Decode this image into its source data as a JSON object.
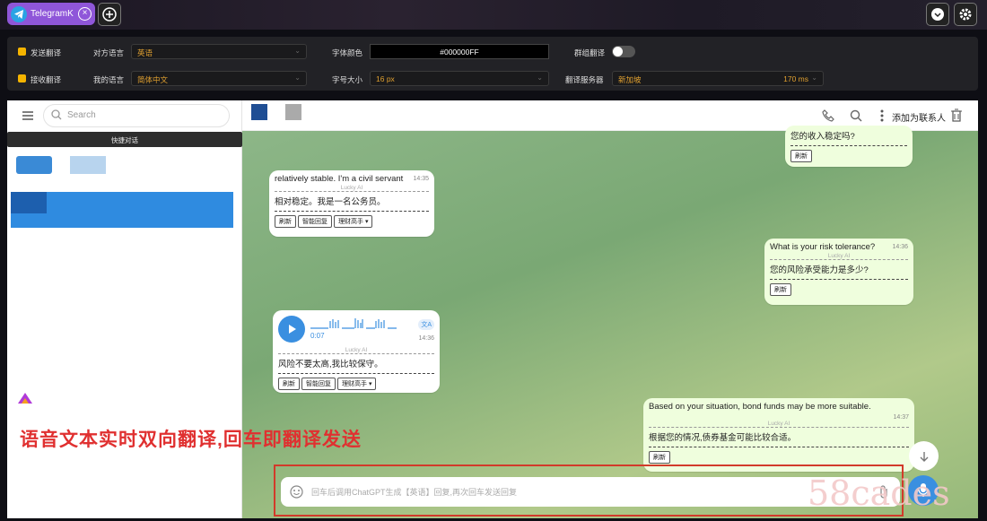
{
  "tab": {
    "title": "TelegramK"
  },
  "settings": {
    "send_translate": "发送翻译",
    "recv_translate": "接收翻译",
    "their_lang_label": "对方语言",
    "their_lang": "英语",
    "my_lang_label": "我的语言",
    "my_lang": "简体中文",
    "font_color_label": "字体颜色",
    "font_color": "#000000FF",
    "font_size_label": "字号大小",
    "font_size": "16 px",
    "group_translate_label": "群组翻译",
    "server_label": "翻译服务器",
    "server": "新加坡",
    "latency": "170 ms"
  },
  "left": {
    "search_placeholder": "Search",
    "quick_label": "快捷对话"
  },
  "header": {
    "add_contact": "添加为联系人"
  },
  "messages": [
    {
      "text": "您的收入稳定吗?",
      "btn": "刷新"
    },
    {
      "text": "relatively stable. I'm a civil servant",
      "time": "14:35",
      "sep": "Lucky AI",
      "tr": "相对稳定。我是一名公务员。",
      "b1": "刷新",
      "b2": "智能回复",
      "b3": "理财高手 ▾"
    },
    {
      "text": "What is your risk tolerance?",
      "time": "14:36",
      "sep": "Lucky AI",
      "tr": "您的风险承受能力是多少?",
      "b1": "刷新"
    },
    {
      "dur": "0:07",
      "time": "14:36",
      "badge": "文A",
      "sep": "Lucky AI",
      "tr": "风险不要太高,我比较保守。",
      "b1": "刷新",
      "b2": "智能回复",
      "b3": "理财高手 ▾"
    },
    {
      "text": "Based on your situation, bond funds may be more suitable.",
      "time": "14:37",
      "sep": "Lucky AI",
      "tr": "根据您的情况,债券基金可能比较合适。",
      "b1": "刷新"
    }
  ],
  "input": {
    "placeholder": "回车后调用ChatGPT生成【英语】回复,再次回车发送回复"
  },
  "caption": "语音文本实时双向翻译,回车即翻译发送",
  "watermark": "58cades"
}
